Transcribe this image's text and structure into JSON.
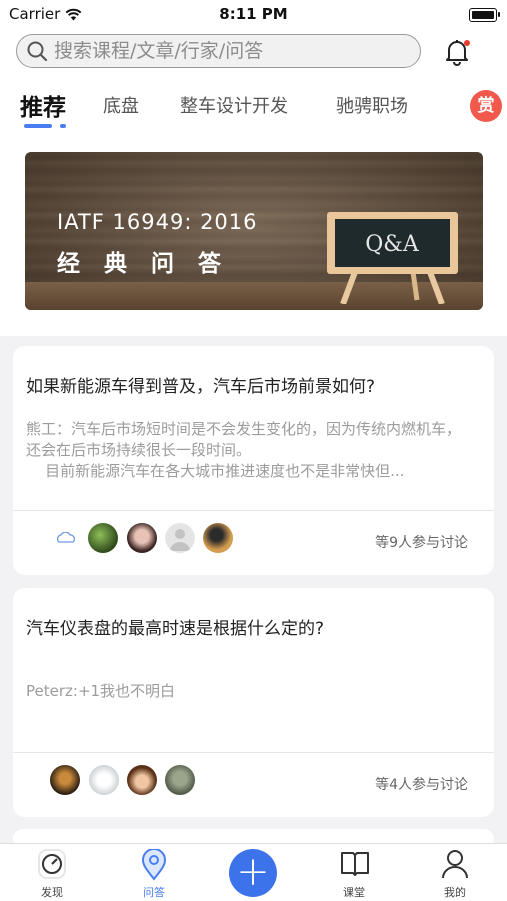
{
  "status_bar": {
    "carrier": "Carrier",
    "time": "8:11 PM"
  },
  "search": {
    "placeholder": "搜索课程/文章/行家/问答"
  },
  "tabs": [
    {
      "label": "推荐",
      "active": true
    },
    {
      "label": "底盘"
    },
    {
      "label": "整车设计开发"
    },
    {
      "label": "驰骋职场"
    }
  ],
  "reward_badge": "赏",
  "banner": {
    "line1": "IATF 16949: 2016",
    "line2": "经典问答",
    "board_text": "Q&A"
  },
  "questions": [
    {
      "title": "如果新能源车得到普及，汽车后市场前景如何?",
      "answer": "熊工：汽车后市场短时间是不会发生变化的，因为传统内燃机车，还会在后市场持续很长一段时间。\n    目前新能源汽车在各大城市推进速度也不是非常快但...",
      "participants": "等9人参与讨论"
    },
    {
      "title": "汽车仪表盘的最高时速是根据什么定的?",
      "answer": "Peterz:+1我也不明白",
      "participants": "等4人参与讨论"
    }
  ],
  "tabbar": {
    "discover": "发现",
    "qa": "问答",
    "add": "+",
    "classroom": "课堂",
    "mine": "我的"
  },
  "colors": {
    "accent": "#3c73ea",
    "reward": "#f0594b",
    "bell_dot": "#e83b2e"
  }
}
